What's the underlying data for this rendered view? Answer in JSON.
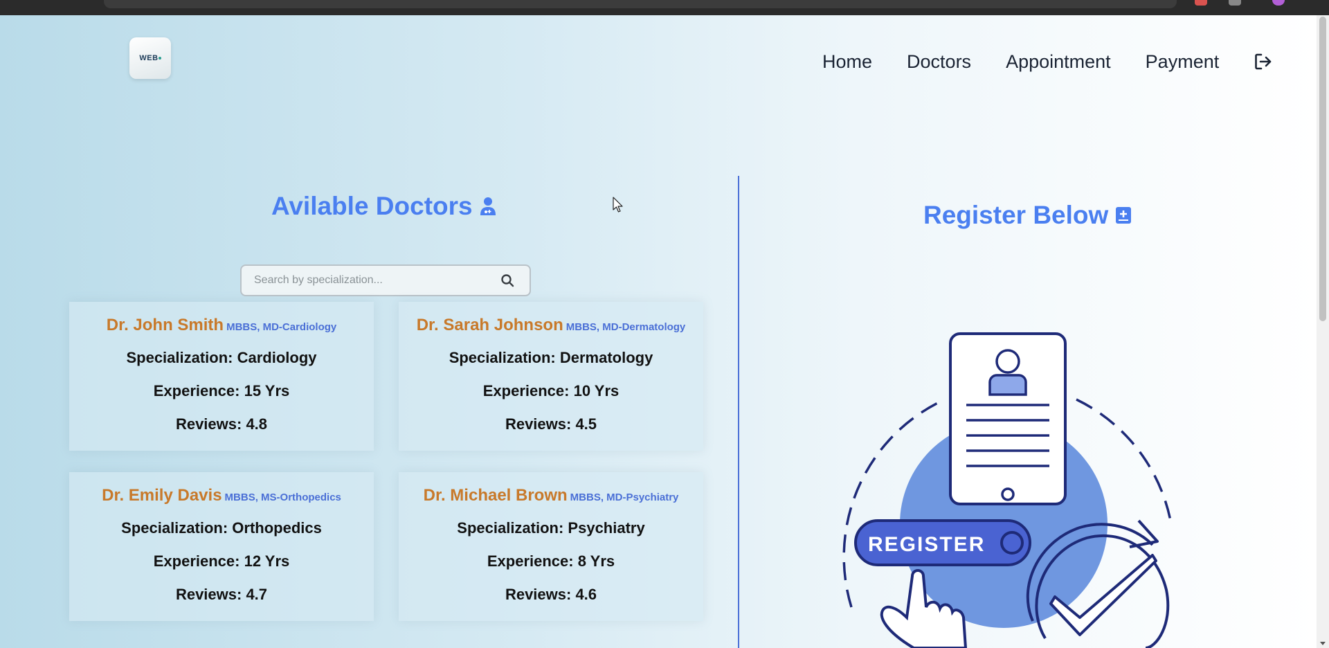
{
  "nav": {
    "logo_text": "WEB",
    "home": "Home",
    "doctors": "Doctors",
    "appointment": "Appointment",
    "payment": "Payment"
  },
  "doctors_section": {
    "title": "Avilable Doctors",
    "search": {
      "placeholder": "Search by specialization...",
      "value": ""
    },
    "cards": [
      {
        "name": "Dr. John Smith",
        "degree": "MBBS, MD-Cardiology",
        "specialization": "Specialization: Cardiology",
        "experience": "Experience: 15 Yrs",
        "reviews": "Reviews: 4.8"
      },
      {
        "name": "Dr. Sarah Johnson",
        "degree": "MBBS, MD-Dermatology",
        "specialization": "Specialization: Dermatology",
        "experience": "Experience: 10 Yrs",
        "reviews": "Reviews: 4.5"
      },
      {
        "name": "Dr. Emily Davis",
        "degree": "MBBS, MS-Orthopedics",
        "specialization": "Specialization: Orthopedics",
        "experience": "Experience: 12 Yrs",
        "reviews": "Reviews: 4.7"
      },
      {
        "name": "Dr. Michael Brown",
        "degree": "MBBS, MD-Psychiatry",
        "specialization": "Specialization: Psychiatry",
        "experience": "Experience: 8 Yrs",
        "reviews": "Reviews: 4.6"
      }
    ]
  },
  "register_section": {
    "title": "Register Below",
    "illustration_button_text": "REGISTER"
  },
  "colors": {
    "accent": "#4a7ff0",
    "doctor_name": "#c8792a",
    "degree": "#4a6fd6",
    "illustration_blue": "#6f97e0",
    "illustration_navy": "#1e2a78"
  },
  "icons": [
    "user-doctor-icon",
    "search-icon",
    "logout-icon",
    "register-plus-icon",
    "mouse-cursor-icon"
  ]
}
